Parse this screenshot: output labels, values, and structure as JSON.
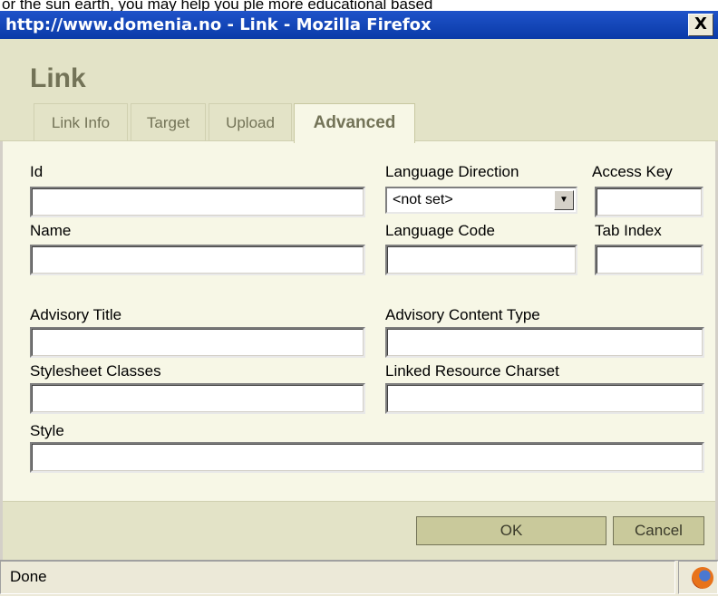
{
  "cut_text": "or the sun earth, you may help you ple more educational based",
  "window": {
    "title": "http://www.domenia.no - Link - Mozilla Firefox",
    "close_label": "X"
  },
  "dialog": {
    "heading": "Link",
    "tabs": [
      {
        "label": "Link Info",
        "active": false
      },
      {
        "label": "Target",
        "active": false
      },
      {
        "label": "Upload",
        "active": false
      },
      {
        "label": "Advanced",
        "active": true
      }
    ],
    "fields": {
      "id": {
        "label": "Id",
        "value": ""
      },
      "lang_dir": {
        "label": "Language Direction",
        "value": "<not set>"
      },
      "access_key": {
        "label": "Access Key",
        "value": ""
      },
      "name": {
        "label": "Name",
        "value": ""
      },
      "lang_code": {
        "label": "Language Code",
        "value": ""
      },
      "tab_index": {
        "label": "Tab Index",
        "value": ""
      },
      "advisory_title": {
        "label": "Advisory Title",
        "value": ""
      },
      "advisory_content_type": {
        "label": "Advisory Content Type",
        "value": ""
      },
      "stylesheet_classes": {
        "label": "Stylesheet Classes",
        "value": ""
      },
      "linked_charset": {
        "label": "Linked Resource Charset",
        "value": ""
      },
      "style": {
        "label": "Style",
        "value": ""
      }
    },
    "buttons": {
      "ok": "OK",
      "cancel": "Cancel"
    }
  },
  "statusbar": {
    "text": "Done",
    "icon": "firefox-icon"
  }
}
